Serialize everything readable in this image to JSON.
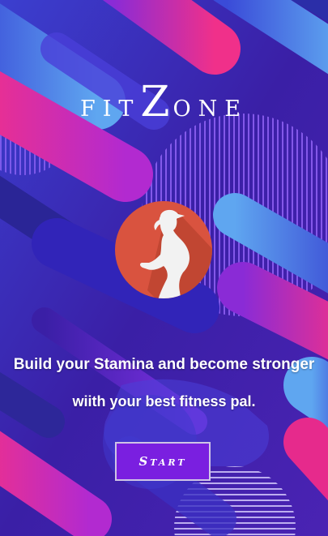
{
  "app": {
    "logo_text": "fitZone"
  },
  "hero": {
    "icon": "runner-icon",
    "circle_color": "#d9533f"
  },
  "tagline": {
    "line1": "Build your Stamina and become stronger",
    "line2": "wiith your best fitness pal."
  },
  "actions": {
    "start_label": "Start"
  },
  "colors": {
    "background": "#3a1fa6",
    "accent_pink": "#e62a8c",
    "accent_blue": "#4f8fe8",
    "button": "#7a1fe0"
  }
}
